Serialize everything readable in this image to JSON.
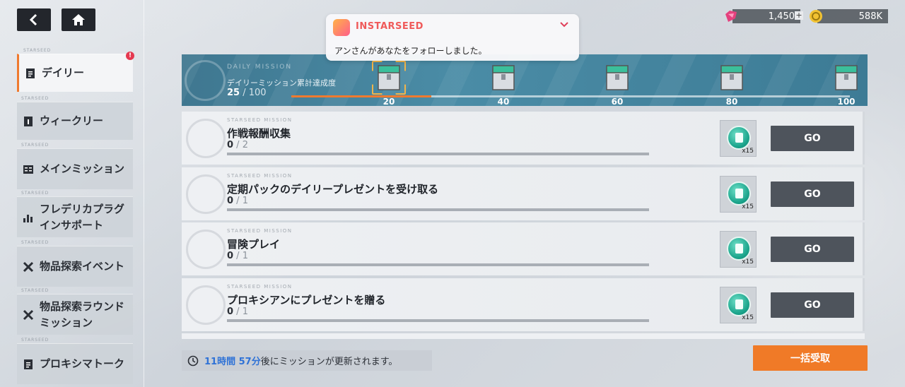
{
  "nav": {
    "back_icon": "back-arrow-icon",
    "home_icon": "home-icon"
  },
  "currency": [
    {
      "icon": "gem-icon",
      "value": "1,450",
      "plus": "+"
    },
    {
      "icon": "coin-icon",
      "value": "588K"
    }
  ],
  "notification": {
    "app_name": "INSTARSEED",
    "message": "アンさんがあなたをフォローしました。"
  },
  "sidebar": {
    "tag": "STARSEED",
    "items": [
      {
        "label": "デイリー",
        "icon": "document-icon",
        "active": true,
        "badge": "!"
      },
      {
        "label": "ウィークリー",
        "icon": "calendar-icon"
      },
      {
        "label": "メインミッション",
        "icon": "book-icon"
      },
      {
        "label": "フレデリカプラグ",
        "label2": "インサポート",
        "icon": "chart-icon"
      },
      {
        "label": "物品探索イベント",
        "icon": "tools-icon"
      },
      {
        "label": "物品探索ラウンド",
        "label2": "ミッション",
        "icon": "tools-icon"
      },
      {
        "label": "プロキシマトーク",
        "icon": "document-icon"
      }
    ]
  },
  "progress": {
    "subtitle": "DAILY MISSION",
    "title": "デイリーミッション累計達成度",
    "current": "25",
    "separator": " / ",
    "total": "100",
    "fill_fraction": 0.25,
    "milestones": [
      "20",
      "40",
      "60",
      "80",
      "100"
    ]
  },
  "missions": [
    {
      "tag": "STARSEED MISSION",
      "name": "作戦報酬収集",
      "current": "0",
      "sep": " / ",
      "total": "2",
      "reward_qty": "x15",
      "button": "GO"
    },
    {
      "tag": "STARSEED MISSION",
      "name": "定期パックのデイリープレゼントを受け取る",
      "current": "0",
      "sep": " / ",
      "total": "1",
      "reward_qty": "x15",
      "button": "GO"
    },
    {
      "tag": "STARSEED MISSION",
      "name": "冒険プレイ",
      "current": "0",
      "sep": " / ",
      "total": "1",
      "reward_qty": "x15",
      "button": "GO"
    },
    {
      "tag": "STARSEED MISSION",
      "name": "プロキシアンにプレゼントを贈る",
      "current": "0",
      "sep": " / ",
      "total": "1",
      "reward_qty": "x15",
      "button": "GO"
    }
  ],
  "footer": {
    "timer_time": "11時間 57分",
    "timer_text": "後にミッションが更新されます。",
    "claim_all": "一括受取"
  },
  "colors": {
    "accent": "#f07a27",
    "banner": "#4a8ca6",
    "timer_blue": "#2f72d6"
  }
}
